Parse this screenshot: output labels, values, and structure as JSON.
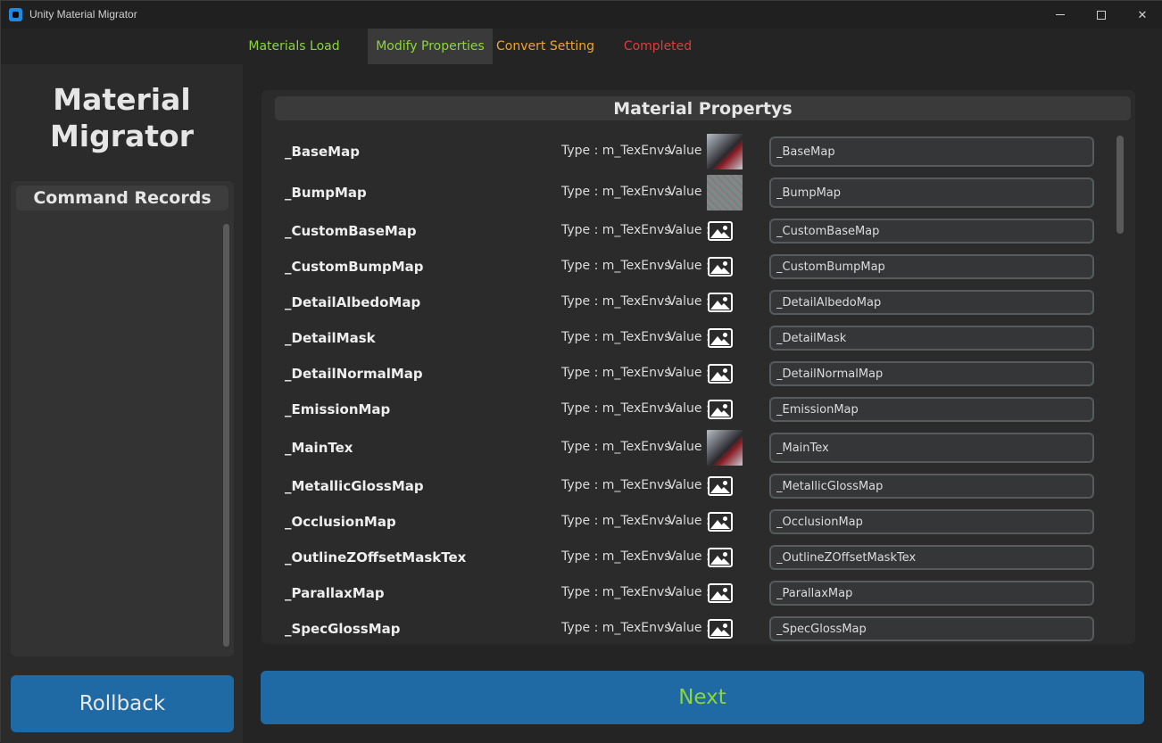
{
  "window": {
    "title": "Unity Material Migrator",
    "minimize_icon": "minimize-icon",
    "maximize_icon": "maximize-icon",
    "close_icon": "close-icon",
    "close_glyph": "✕"
  },
  "tabs": [
    {
      "label": "Materials Load",
      "color": "#8cd63c"
    },
    {
      "label": "Modify Properties",
      "color": "#8cd63c",
      "active": true
    },
    {
      "label": "Convert Setting",
      "color": "#f0a52e"
    },
    {
      "label": "Completed",
      "color": "#e03c3c"
    }
  ],
  "sidebar": {
    "brand_line1": "Material",
    "brand_line2": "Migrator",
    "command_records_title": "Command Records",
    "rollback_label": "Rollback"
  },
  "properties": {
    "title": "Material Propertys",
    "rows": [
      {
        "name": "_BaseMap",
        "type": "Type : m_TexEnvs",
        "value_label": "Value :",
        "thumb": "texture-thumbnail-base",
        "input": "_BaseMap"
      },
      {
        "name": "_BumpMap",
        "type": "Type : m_TexEnvs",
        "value_label": "Value :",
        "thumb": "texture-thumbnail-bump",
        "input": "_BumpMap"
      },
      {
        "name": "_CustomBaseMap",
        "type": "Type : m_TexEnvs",
        "value_label": "Value :",
        "thumb": "image-placeholder-icon",
        "input": "_CustomBaseMap"
      },
      {
        "name": "_CustomBumpMap",
        "type": "Type : m_TexEnvs",
        "value_label": "Value :",
        "thumb": "image-placeholder-icon",
        "input": "_CustomBumpMap"
      },
      {
        "name": "_DetailAlbedoMap",
        "type": "Type : m_TexEnvs",
        "value_label": "Value :",
        "thumb": "image-placeholder-icon",
        "input": "_DetailAlbedoMap"
      },
      {
        "name": "_DetailMask",
        "type": "Type : m_TexEnvs",
        "value_label": "Value :",
        "thumb": "image-placeholder-icon",
        "input": "_DetailMask"
      },
      {
        "name": "_DetailNormalMap",
        "type": "Type : m_TexEnvs",
        "value_label": "Value :",
        "thumb": "image-placeholder-icon",
        "input": "_DetailNormalMap"
      },
      {
        "name": "_EmissionMap",
        "type": "Type : m_TexEnvs",
        "value_label": "Value :",
        "thumb": "image-placeholder-icon",
        "input": "_EmissionMap"
      },
      {
        "name": "_MainTex",
        "type": "Type : m_TexEnvs",
        "value_label": "Value :",
        "thumb": "texture-thumbnail-base",
        "input": "_MainTex"
      },
      {
        "name": "_MetallicGlossMap",
        "type": "Type : m_TexEnvs",
        "value_label": "Value :",
        "thumb": "image-placeholder-icon",
        "input": "_MetallicGlossMap"
      },
      {
        "name": "_OcclusionMap",
        "type": "Type : m_TexEnvs",
        "value_label": "Value :",
        "thumb": "image-placeholder-icon",
        "input": "_OcclusionMap"
      },
      {
        "name": "_OutlineZOffsetMaskTex",
        "type": "Type : m_TexEnvs",
        "value_label": "Value :",
        "thumb": "image-placeholder-icon",
        "input": "_OutlineZOffsetMaskTex"
      },
      {
        "name": "_ParallaxMap",
        "type": "Type : m_TexEnvs",
        "value_label": "Value :",
        "thumb": "image-placeholder-icon",
        "input": "_ParallaxMap"
      },
      {
        "name": "_SpecGlossMap",
        "type": "Type : m_TexEnvs",
        "value_label": "Value :",
        "thumb": "image-placeholder-icon",
        "input": "_SpecGlossMap"
      }
    ]
  },
  "footer": {
    "next_label": "Next"
  },
  "colors": {
    "accent_blue": "#1f6aa5",
    "green": "#8cd63c",
    "orange": "#f0a52e",
    "red": "#e03c3c"
  }
}
